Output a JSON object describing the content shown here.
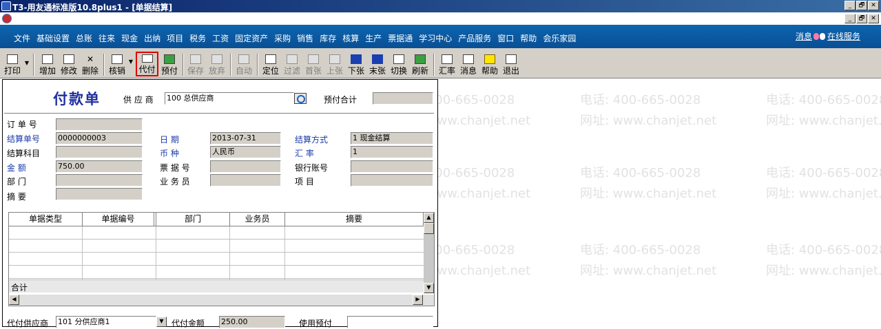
{
  "window": {
    "title": "T3-用友通标准版10.8plus1 - [单据结算]"
  },
  "window_buttons": {
    "minimize": "_",
    "restore": "🗗",
    "close": "✕"
  },
  "menu": {
    "items": [
      "文件",
      "基础设置",
      "总账",
      "往来",
      "现金",
      "出纳",
      "项目",
      "税务",
      "工资",
      "固定资产",
      "采购",
      "销售",
      "库存",
      "核算",
      "生产",
      "票据通",
      "学习中心",
      "产品服务",
      "窗口",
      "帮助",
      "会乐家园"
    ],
    "message_label": "消息",
    "online_service_label": "在线服务"
  },
  "toolbar": {
    "print": "打印",
    "add": "增加",
    "edit": "修改",
    "delete": "删除",
    "verify": "核销",
    "proxy_pay": "代付",
    "prepay": "预付",
    "save": "保存",
    "discard": "放弃",
    "auto": "自动",
    "locate": "定位",
    "filter": "过滤",
    "first": "首张",
    "prev": "上张",
    "next": "下张",
    "last": "末张",
    "switch": "切换",
    "refresh": "刷新",
    "exchange_rate": "汇率",
    "message": "消息",
    "help": "帮助",
    "exit": "退出"
  },
  "watermark": {
    "phone": "电话: 400-665-0028",
    "site": "网址: www.chanjet.net"
  },
  "form": {
    "title": "付款单",
    "supplier_label": "供 应 商",
    "supplier_value": "100   总供应商",
    "prepay_total_label": "预付合计",
    "prepay_total_value": "",
    "order_no_label": "订 单 号",
    "order_no_value": "",
    "settle_no_label": "结算单号",
    "settle_no_value": "0000000003",
    "date_label": "日    期",
    "date_value": "2013-07-31",
    "settle_method_label": "结算方式",
    "settle_method_value": "1   现金结算",
    "settle_subject_label": "结算科目",
    "settle_subject_value": "",
    "currency_label": "币    种",
    "currency_value": "人民币",
    "rate_label": "汇      率",
    "rate_value": "1",
    "amount_label": "金    额",
    "amount_value": "750.00",
    "bill_no_label": "票 据 号",
    "bill_no_value": "",
    "bank_account_label": "银行账号",
    "bank_account_value": "",
    "dept_label": "部    门",
    "dept_value": "",
    "salesman_label": "业 务 员",
    "salesman_value": "",
    "project_label": "项    目",
    "project_value": "",
    "summary_label": "摘    要",
    "summary_value": "",
    "proxy_supplier_label": "代付供应商",
    "proxy_supplier_value": "101   分供应商1",
    "proxy_amount_label": "代付金额",
    "proxy_amount_value": "250.00",
    "use_prepay_label": "使用预付",
    "use_prepay_value": ""
  },
  "grid": {
    "columns": [
      "单据类型",
      "单据编号",
      "",
      "部门",
      "业务员",
      "摘要"
    ],
    "total_label": "合计",
    "rows": []
  },
  "colors": {
    "menubar": "#0c65b0",
    "title_blue": "#1f2fa0",
    "highlight": "#e00000",
    "label_blue": "#1a3aa8"
  }
}
